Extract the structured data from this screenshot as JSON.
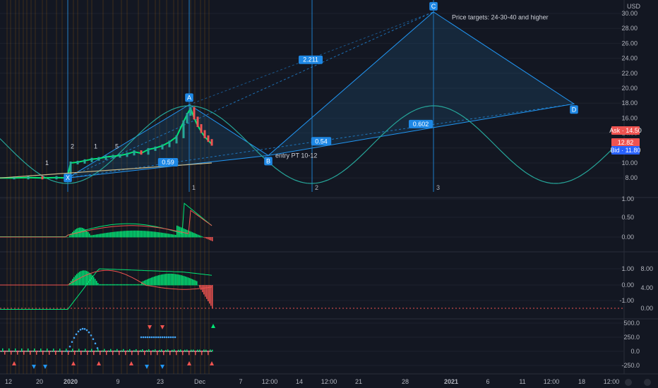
{
  "chart_data": [
    {
      "type": "line",
      "currency_label": "USD",
      "y_ticks": [
        "30.00",
        "28.00",
        "26.00",
        "24.00",
        "22.00",
        "20.00",
        "18.00",
        "16.00",
        "14.00",
        "12.00",
        "10.00",
        "8.00"
      ],
      "price_series": [
        {
          "x": 0,
          "y": 8.0
        },
        {
          "x": 20,
          "y": 8.0
        },
        {
          "x": 40,
          "y": 8.05
        },
        {
          "x": 60,
          "y": 8.0
        },
        {
          "x": 80,
          "y": 8.05
        },
        {
          "x": 95,
          "y": 8.0
        },
        {
          "x": 100,
          "y": 10.0
        },
        {
          "x": 110,
          "y": 10.1
        },
        {
          "x": 120,
          "y": 10.3
        },
        {
          "x": 130,
          "y": 10.5
        },
        {
          "x": 140,
          "y": 10.6
        },
        {
          "x": 150,
          "y": 10.8
        },
        {
          "x": 160,
          "y": 10.9
        },
        {
          "x": 170,
          "y": 11.0
        },
        {
          "x": 180,
          "y": 11.2
        },
        {
          "x": 190,
          "y": 11.5
        },
        {
          "x": 200,
          "y": 11.3
        },
        {
          "x": 210,
          "y": 11.8
        },
        {
          "x": 220,
          "y": 12.0
        },
        {
          "x": 230,
          "y": 12.3
        },
        {
          "x": 240,
          "y": 12.8
        },
        {
          "x": 250,
          "y": 13.5
        },
        {
          "x": 260,
          "y": 15.5
        },
        {
          "x": 265,
          "y": 16.5
        },
        {
          "x": 270,
          "y": 17.3
        },
        {
          "x": 275,
          "y": 16.0
        },
        {
          "x": 280,
          "y": 15.0
        },
        {
          "x": 285,
          "y": 14.2
        },
        {
          "x": 290,
          "y": 13.5
        },
        {
          "x": 295,
          "y": 13.0
        },
        {
          "x": 300,
          "y": 12.5
        }
      ],
      "pattern_points": [
        {
          "label": "X",
          "x": 96,
          "y": 8.0
        },
        {
          "label": "A",
          "x": 268,
          "y": 17.8
        },
        {
          "label": "B",
          "x": 380,
          "y": 11.0
        },
        {
          "label": "C",
          "x": 614,
          "y": 30.2
        },
        {
          "label": "D",
          "x": 813,
          "y": 17.9
        }
      ],
      "ratios": [
        {
          "text": "0.59",
          "x": 238,
          "y": 10.1
        },
        {
          "text": "2.211",
          "x": 440,
          "y": 23.8
        },
        {
          "text": "0.54",
          "x": 455,
          "y": 12.9
        },
        {
          "text": "0.602",
          "x": 596,
          "y": 15.2
        }
      ],
      "annotations": [
        {
          "text": "Price targets: 24-30-40 and higher",
          "x": 640,
          "y": 29.5
        },
        {
          "text": "entry PT 10-12",
          "x": 390,
          "y": 11.0
        },
        {
          "text": "2",
          "x": 100,
          "y": 12.2
        },
        {
          "text": "1",
          "x": 133,
          "y": 12.2
        },
        {
          "text": "5",
          "x": 163,
          "y": 12.2
        },
        {
          "text": "1",
          "x": 64,
          "y": 10.0
        }
      ],
      "cycle_markers": [
        "1",
        "2",
        "3"
      ],
      "price_labels": [
        {
          "text": "Ask · 14.50",
          "value": 14.5,
          "color": "#ef5350"
        },
        {
          "text": "12.82",
          "value": 12.82,
          "color": "#ef5350"
        },
        {
          "text": "Bid · 11.80",
          "value": 11.8,
          "color": "#2962ff"
        }
      ]
    },
    {
      "type": "bar",
      "name": "oscillator-1",
      "y_ticks": [
        "1.00",
        "0.50",
        "0.00"
      ]
    },
    {
      "type": "bar",
      "name": "oscillator-2",
      "y_ticks_left": [
        "1.00",
        "0.00",
        "-1.00"
      ],
      "y_ticks_right": [
        "8.00",
        "4.00",
        "0.00"
      ]
    },
    {
      "type": "scatter",
      "name": "oscillator-3",
      "y_ticks": [
        "500.0",
        "250.0",
        "0.0",
        "-250.0"
      ]
    }
  ],
  "x_axis": {
    "ticks": [
      {
        "label": "12",
        "x": 12
      },
      {
        "label": "20",
        "x": 56
      },
      {
        "label": "2020",
        "x": 100
      },
      {
        "label": "9",
        "x": 167
      },
      {
        "label": "23",
        "x": 227
      },
      {
        "label": "Dec",
        "x": 283
      },
      {
        "label": "7",
        "x": 341
      },
      {
        "label": "12:00",
        "x": 382
      },
      {
        "label": "14",
        "x": 424
      },
      {
        "label": "12:00",
        "x": 466
      },
      {
        "label": "21",
        "x": 508
      },
      {
        "label": "28",
        "x": 574
      },
      {
        "label": "2021",
        "x": 639
      },
      {
        "label": "6",
        "x": 691
      },
      {
        "label": "11",
        "x": 740
      },
      {
        "label": "12:00",
        "x": 781
      },
      {
        "label": "18",
        "x": 824
      },
      {
        "label": "12:00",
        "x": 866
      }
    ]
  },
  "colors": {
    "background": "#131722",
    "pattern_fill": "#1e5a88",
    "pattern_stroke": "#2196f3",
    "sine": "#26a69a",
    "green": "#26a69a",
    "red": "#ef5350",
    "bright_green": "#00e676",
    "badge": "#1e88e5",
    "grid": "#1e222d"
  },
  "icons": {
    "toggle": "toggle-circle-icon"
  }
}
